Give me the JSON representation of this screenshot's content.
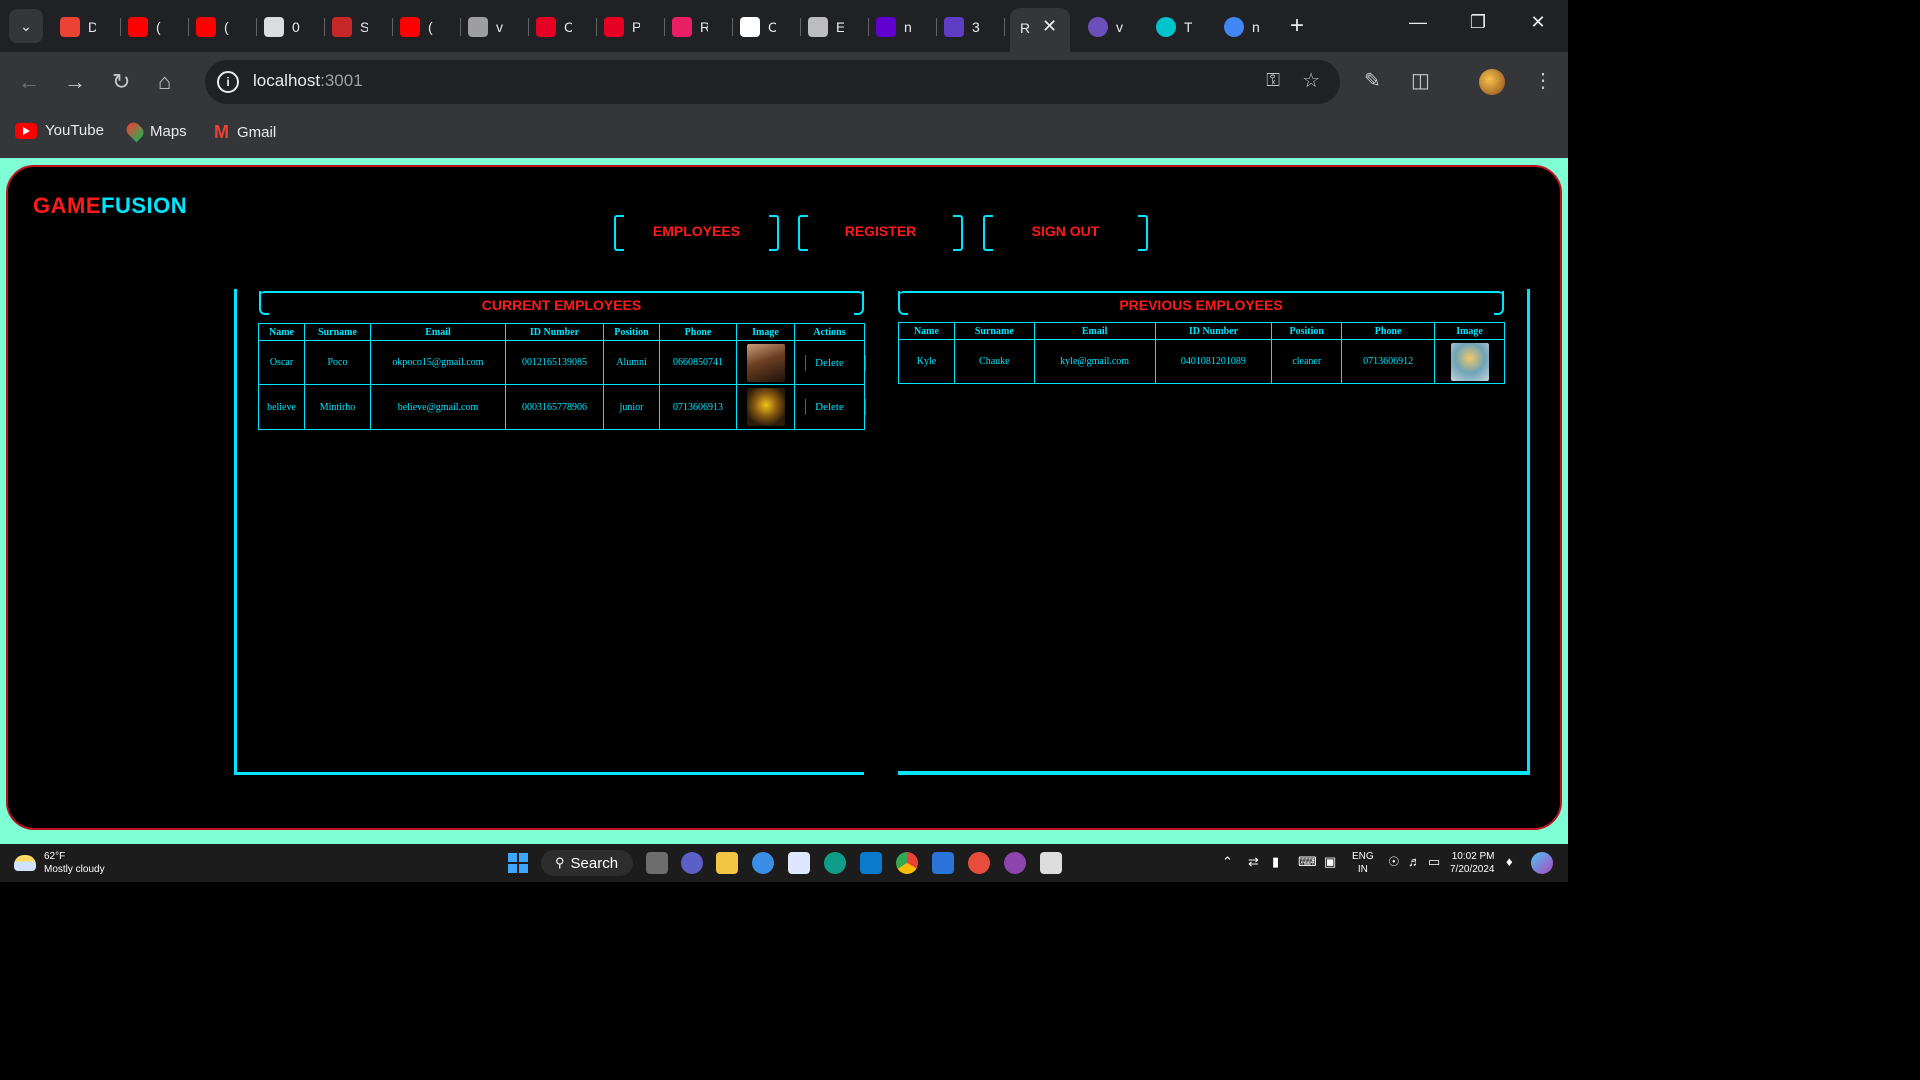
{
  "browser": {
    "tabs": [
      {
        "icon": "gmail-icon",
        "title": "D",
        "color": "#ea4335"
      },
      {
        "icon": "youtube-icon",
        "title": "(",
        "color": "#ff0000"
      },
      {
        "icon": "youtube-icon",
        "title": "(",
        "color": "#ff0000"
      },
      {
        "icon": "store-icon",
        "title": "0",
        "color": "#dadce0"
      },
      {
        "icon": "spider-icon",
        "title": "S",
        "color": "#c62828"
      },
      {
        "icon": "youtube-icon",
        "title": "(",
        "color": "#ff0000"
      },
      {
        "icon": "layers-icon",
        "title": "v",
        "color": "#9e9e9e"
      },
      {
        "icon": "pinterest-icon",
        "title": "C",
        "color": "#e60023"
      },
      {
        "icon": "pinterest-icon",
        "title": "P",
        "color": "#e60023"
      },
      {
        "icon": "react-icon",
        "title": "R",
        "color": "#e91e63"
      },
      {
        "icon": "openai-icon",
        "title": "C",
        "color": "#ffffff"
      },
      {
        "icon": "globe-icon",
        "title": "E",
        "color": "#bdbdbd"
      },
      {
        "icon": "yahoo-icon",
        "title": "n",
        "color": "#6001d2"
      },
      {
        "icon": "colorlib-icon",
        "title": "3",
        "color": "#5f3dc4"
      }
    ],
    "active_tab": {
      "title": "R",
      "close": "✕"
    },
    "tabs_after": [
      {
        "icon": "vite-icon",
        "title": "v",
        "color": "#6b4fbb"
      },
      {
        "icon": "canva-icon",
        "title": "T",
        "color": "#00c4cc"
      },
      {
        "icon": "window-icon",
        "title": "n",
        "color": "#4285f4"
      }
    ],
    "new_tab": "+",
    "url_host": "localhost",
    "url_port": ":3001",
    "bookmarks": [
      {
        "label": "YouTube",
        "icon": "youtube-icon"
      },
      {
        "label": "Maps",
        "icon": "maps-pin-icon"
      },
      {
        "label": "Gmail",
        "icon": "gmail-icon"
      }
    ]
  },
  "app": {
    "logo_part1": "GAME",
    "logo_part2": "FUSION",
    "nav": [
      {
        "label": "EMPLOYEES"
      },
      {
        "label": "REGISTER"
      },
      {
        "label": "SIGN OUT"
      }
    ],
    "current": {
      "title": "CURRENT EMPLOYEES",
      "columns": [
        "Name",
        "Surname",
        "Email",
        "ID Number",
        "Position",
        "Phone",
        "Image",
        "Actions"
      ],
      "rows": [
        {
          "name": "Oscar",
          "surname": "Poco",
          "email": "okpoco15@gmail.com",
          "id_number": "0012165139085",
          "position": "Alumni",
          "phone": "0660850741",
          "action": "Delete"
        },
        {
          "name": "believe",
          "surname": "Mintirho",
          "email": "believe@gmail.com",
          "id_number": "0003165778906",
          "position": "junior",
          "phone": "0713606913",
          "action": "Delete"
        }
      ]
    },
    "previous": {
      "title": "PREVIOUS EMPLOYEES",
      "columns": [
        "Name",
        "Surname",
        "Email",
        "ID Number",
        "Position",
        "Phone",
        "Image"
      ],
      "rows": [
        {
          "name": "Kyle",
          "surname": "Chauke",
          "email": "kyle@gmail.com",
          "id_number": "0401081201089",
          "position": "cleaner",
          "phone": "0713606912"
        }
      ]
    },
    "colors": {
      "accent_red": "#ff1a1a",
      "accent_cyan": "#00e5ff",
      "page_bg": "#7fffd4"
    }
  },
  "taskbar": {
    "weather_temp": "62°F",
    "weather_desc": "Mostly cloudy",
    "search_label": "Search",
    "lang_line1": "ENG",
    "lang_line2": "IN",
    "time": "10:02 PM",
    "date": "7/20/2024"
  }
}
